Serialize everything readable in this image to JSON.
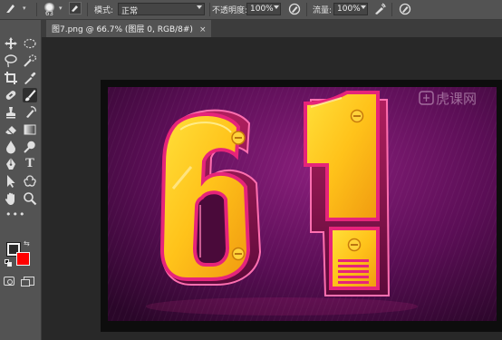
{
  "options_bar": {
    "brush_size": "63",
    "mode_label": "模式:",
    "mode_value": "正常",
    "opacity_label": "不透明度:",
    "opacity_value": "100%",
    "flow_label": "流量:",
    "flow_value": "100%"
  },
  "document_tab": {
    "title": "图7.png @ 66.7% (图层 0, RGB/8#)",
    "close": "×"
  },
  "artwork": {
    "watermark": "虎课网",
    "text": "61"
  },
  "colors": {
    "background_swatch": "#ff0000",
    "foreground_swatch": "#2a2a2a"
  }
}
